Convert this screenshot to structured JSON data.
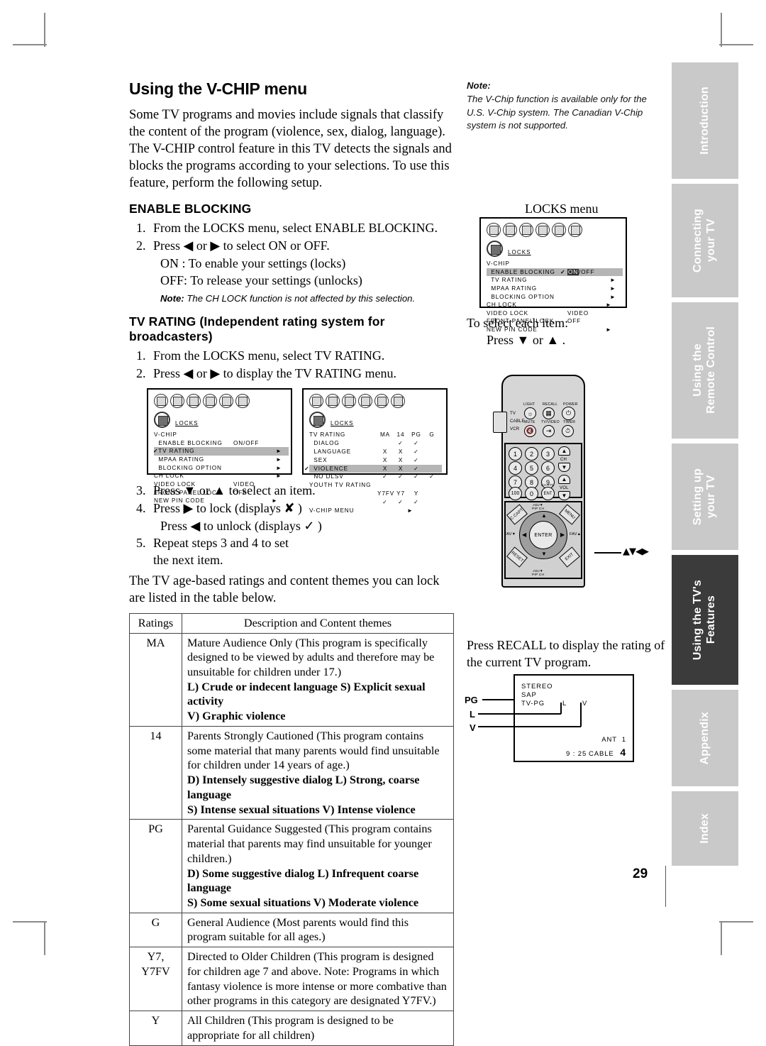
{
  "page": {
    "number": "29"
  },
  "sidebar": {
    "tabs": [
      {
        "label": "Introduction",
        "active": false
      },
      {
        "label": "Connecting\nyour TV",
        "active": false
      },
      {
        "label": "Using the\nRemote Control",
        "active": false
      },
      {
        "label": "Setting up\nyour TV",
        "active": false
      },
      {
        "label": "Using the TV's\nFeatures",
        "active": true
      },
      {
        "label": "Appendix",
        "active": false
      },
      {
        "label": "Index",
        "active": false
      }
    ]
  },
  "left": {
    "title": "Using the V-CHIP menu",
    "intro": "Some TV programs and movies include signals that classify the content of the program (violence, sex, dialog, language). The V-CHIP control feature in this TV detects the signals and blocks the programs according to your selections. To use this feature, perform the following setup.",
    "enable_heading": "ENABLE BLOCKING",
    "enable_steps": [
      {
        "num": "1.",
        "text": "From the LOCKS menu, select ENABLE BLOCKING."
      },
      {
        "num": "2.",
        "text": "Press ◀ or ▶ to select ON or OFF."
      }
    ],
    "enable_on": "ON : To enable your settings (locks)",
    "enable_off": "OFF: To release your settings (unlocks)",
    "enable_note_label": "Note:",
    "enable_note_text": "The CH LOCK function is not affected by this selection.",
    "tvrating_heading": "TV RATING (Independent rating system for broadcasters)",
    "tvrating_steps": [
      {
        "num": "1.",
        "text": "From the LOCKS menu, select TV RATING."
      },
      {
        "num": "2.",
        "text": "Press ◀ or ▶ to display the TV RATING menu."
      }
    ],
    "post_steps": [
      {
        "num": "3.",
        "text": "Press ▼ or ▲ to select an item."
      },
      {
        "num": "4.",
        "text": "Press ▶ to lock (displays ✘ )"
      }
    ],
    "unlock_line": "Press ◀ to unlock (displays ✓ )",
    "step5": {
      "num": "5.",
      "text": "Repeat steps 3 and 4 to set\nthe next item."
    },
    "table_intro": "The TV age-based ratings and content themes you can lock are listed in the table below."
  },
  "osd_locks_left": {
    "locks_label": "LOCKS",
    "rows": [
      {
        "key": "V-CHIP",
        "value": "",
        "arrow": false,
        "highlight": false,
        "check": false
      },
      {
        "key": "  ENABLE BLOCKING",
        "value": "ON/OFF",
        "arrow": false,
        "highlight": false,
        "check": false
      },
      {
        "key": "  TV RATING",
        "value": "",
        "arrow": true,
        "highlight": true,
        "check": true
      },
      {
        "key": "  MPAA RATING",
        "value": "",
        "arrow": true,
        "highlight": false,
        "check": false
      },
      {
        "key": "  BLOCKING OPTION",
        "value": "",
        "arrow": true,
        "highlight": false,
        "check": false
      },
      {
        "key": "CH LOCK",
        "value": "",
        "arrow": true,
        "highlight": false,
        "check": false
      },
      {
        "key": "VIDEO LOCK",
        "value": "VIDEO",
        "arrow": false,
        "highlight": false,
        "check": false
      },
      {
        "key": "FRONT PANEL LOCK",
        "value": "OFF",
        "arrow": false,
        "highlight": false,
        "check": false
      },
      {
        "key": "NEW PIN CODE",
        "value": "",
        "arrow": true,
        "highlight": false,
        "check": false
      }
    ]
  },
  "osd_tvrating": {
    "locks_label": "LOCKS",
    "header": {
      "title": "TV RATING",
      "cols": [
        "MA",
        "14",
        "PG",
        "G"
      ]
    },
    "rows": [
      {
        "key": "  DIALOG",
        "cells": [
          "",
          "✓",
          "✓",
          ""
        ],
        "highlight": false,
        "check": false
      },
      {
        "key": "  LANGUAGE",
        "cells": [
          "X",
          "X",
          "✓",
          ""
        ],
        "highlight": false,
        "check": false
      },
      {
        "key": "  SEX",
        "cells": [
          "X",
          "X",
          "✓",
          ""
        ],
        "highlight": false,
        "check": false
      },
      {
        "key": "  VIOLENCE",
        "cells": [
          "X",
          "X",
          "✓",
          ""
        ],
        "highlight": true,
        "check": true
      },
      {
        "key": "  NO DLSV",
        "cells": [
          "✓",
          "✓",
          "✓",
          "✓"
        ],
        "highlight": false,
        "check": false
      }
    ],
    "youth_label": "YOUTH TV RATING",
    "youth_cols": [
      "Y7FV",
      "Y7",
      "Y"
    ],
    "youth_cells": [
      "✓",
      "✓",
      "✓"
    ],
    "footer": "V-CHIP MENU"
  },
  "table": {
    "headers": [
      "Ratings",
      "Description and Content themes"
    ],
    "rows": [
      {
        "rating": "MA",
        "desc": "Mature Audience Only (This program is specifically designed to be viewed by adults and therefore may be unsuitable for children under 17.)",
        "themes": [
          "L) Crude or indecent language  S) Explicit sexual activity",
          "V) Graphic violence"
        ]
      },
      {
        "rating": "14",
        "desc": "Parents Strongly Cautioned (This program contains some material that many parents would find unsuitable for children under 14 years of age.)",
        "themes": [
          "D) Intensely suggestive dialog  L) Strong, coarse language",
          "S) Intense sexual situations  V) Intense violence"
        ]
      },
      {
        "rating": "PG",
        "desc": "Parental Guidance Suggested (This program contains material that parents may find unsuitable for younger children.)",
        "themes": [
          "D) Some suggestive dialog  L) Infrequent coarse language",
          "S) Some sexual situations  V) Moderate violence"
        ]
      },
      {
        "rating": "G",
        "desc": "General Audience (Most parents would find this program suitable for all ages.)",
        "themes": []
      },
      {
        "rating": "Y7,\nY7FV",
        "desc": "Directed to Older Children (This program is designed for children age 7 and above. Note: Programs in which fantasy violence is more intense or more combative than other programs in this category are designated Y7FV.)",
        "themes": []
      },
      {
        "rating": "Y",
        "desc": "All Children (This program is designed to be appropriate for all children)",
        "themes": []
      }
    ]
  },
  "right": {
    "note_label": "Note:",
    "note_text": "The V-Chip function is available only for the U.S. V-Chip system. The Canadian V-Chip system is not supported.",
    "locks_menu_caption": "LOCKS menu",
    "select_item_line": "To select each item:",
    "select_item_press": "Press ▼ or ▲ .",
    "recall_text": "Press RECALL to display the rating of the current TV program.",
    "dpad_arrows": "▲▼◀▶"
  },
  "osd_locks_right": {
    "locks_label": "LOCKS",
    "rows": [
      {
        "key": "V-CHIP",
        "value": "",
        "arrow": false,
        "highlight": false
      },
      {
        "key": "  ENABLE BLOCKING",
        "value": "ON/OFF",
        "arrow": false,
        "highlight": true
      },
      {
        "key": "  TV RATING",
        "value": "",
        "arrow": true,
        "highlight": false
      },
      {
        "key": "  MPAA RATING",
        "value": "",
        "arrow": true,
        "highlight": false
      },
      {
        "key": "  BLOCKING OPTION",
        "value": "",
        "arrow": true,
        "highlight": false
      },
      {
        "key": "CH LOCK",
        "value": "",
        "arrow": true,
        "highlight": false
      },
      {
        "key": "VIDEO LOCK",
        "value": "VIDEO",
        "arrow": false,
        "highlight": false
      },
      {
        "key": "FRONT PANEL LOCK",
        "value": "OFF",
        "arrow": false,
        "highlight": false
      },
      {
        "key": "NEW PIN CODE",
        "value": "",
        "arrow": true,
        "highlight": false
      }
    ]
  },
  "remote": {
    "top_labels": [
      "LIGHT",
      "RECALL",
      "POWER",
      "MUTE",
      "TV/VIDEO",
      "TIMER"
    ],
    "mode_labels": [
      "TV",
      "CABLE",
      "VCR"
    ],
    "keys": [
      "1",
      "2",
      "3",
      "4",
      "5",
      "6",
      "7",
      "8",
      "9",
      "100",
      "0",
      "ENT"
    ],
    "ch_label": "CH",
    "vol_label": "VOL",
    "chrtn_label": "CH.RTN",
    "enter_label": "ENTER",
    "pad_top_label": "ADJ▼\nPIP CH",
    "pad_bottom_label": "ADJ▼\nPIP CH",
    "fav_down": "FAV▼",
    "fav_up": "FAV▲",
    "corner_labels": [
      "C.CAPT",
      "MENU",
      "RESET",
      "EXIT"
    ]
  },
  "tv_display": {
    "lines": [
      "STEREO",
      "SAP",
      "TV-PG"
    ],
    "content_flags": [
      "L",
      "V"
    ],
    "callouts": [
      "PG",
      "L",
      "V"
    ],
    "ant": "ANT  1",
    "time": "9 : 25",
    "source": "CABLE",
    "channel": "4"
  }
}
